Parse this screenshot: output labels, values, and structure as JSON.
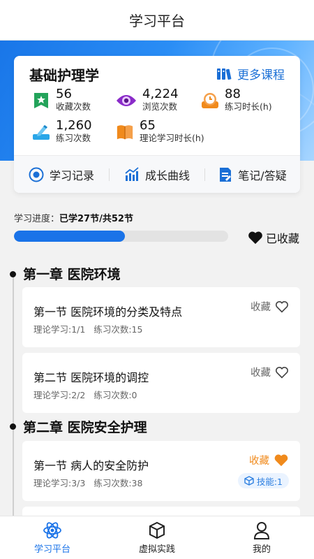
{
  "header": {
    "title": "学习平台"
  },
  "course": {
    "title": "基础护理学",
    "more_label": "更多课程",
    "stats": [
      {
        "value": "56",
        "label": "收藏次数",
        "icon": "bookmark-star-icon",
        "color": "#23a35a"
      },
      {
        "value": "4,224",
        "label": "浏览次数",
        "icon": "eye-icon",
        "color": "#8a2bc9"
      },
      {
        "value": "88",
        "label": "练习时长(h)",
        "icon": "timer-icon",
        "color": "#f08a1c"
      },
      {
        "value": "1,260",
        "label": "练习次数",
        "icon": "pencil-icon",
        "color": "#2aa6e8"
      },
      {
        "value": "65",
        "label": "理论学习时长(h)",
        "icon": "book-icon",
        "color": "#f08a1c"
      }
    ],
    "actions": [
      {
        "label": "学习记录",
        "icon": "clock-icon"
      },
      {
        "label": "成长曲线",
        "icon": "growth-chart-icon"
      },
      {
        "label": "笔记/答疑",
        "icon": "note-icon"
      }
    ]
  },
  "progress": {
    "prefix": "学习进度：",
    "text": "已学27节/共52节",
    "learned": 27,
    "total": 52,
    "favorite_label": "已收藏"
  },
  "chapters": [
    {
      "title": "第一章 医院环境",
      "sections": [
        {
          "title": "第一节 医院环境的分类及特点",
          "theory": "理论学习:1/1",
          "practice": "练习次数:15",
          "fav_label": "收藏",
          "favorited": false
        },
        {
          "title": "第二节 医院环境的调控",
          "theory": "理论学习:2/2",
          "practice": "练习次数:0",
          "fav_label": "收藏",
          "favorited": false
        }
      ]
    },
    {
      "title": "第二章 医院安全护理",
      "sections": [
        {
          "title": "第一节 病人的安全防护",
          "theory": "理论学习:3/3",
          "practice": "练习次数:38",
          "fav_label": "收藏",
          "favorited": true,
          "skill": "技能:1"
        }
      ]
    }
  ],
  "nav": {
    "tabs": [
      {
        "label": "学习平台",
        "icon": "atom-icon",
        "active": true
      },
      {
        "label": "虚拟实践",
        "icon": "cube-icon",
        "active": false
      },
      {
        "label": "我的",
        "icon": "user-icon",
        "active": false
      }
    ]
  },
  "colors": {
    "primary": "#1a73e8",
    "accent": "#f08a1c",
    "progress_track": "#e3e3e3"
  }
}
